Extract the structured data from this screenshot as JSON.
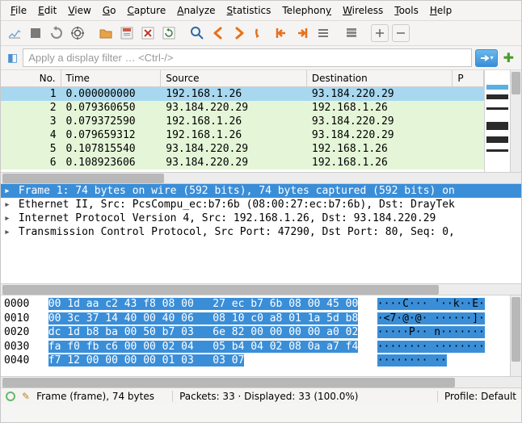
{
  "menu": {
    "file": "File",
    "edit": "Edit",
    "view": "View",
    "go": "Go",
    "capture": "Capture",
    "analyze": "Analyze",
    "statistics": "Statistics",
    "telephony": "Telephony",
    "wireless": "Wireless",
    "tools": "Tools",
    "help": "Help"
  },
  "toolbar_icons": [
    "fin-icon",
    "stop-icon",
    "restart-icon",
    "options-icon",
    "open-icon",
    "save-icon",
    "close-icon",
    "reload-icon",
    "find-icon",
    "back-icon",
    "forward-icon",
    "jump-icon",
    "first-icon",
    "last-icon",
    "autoscroll-icon",
    "colorize-icon",
    "zoom-in-icon",
    "zoom-out-icon"
  ],
  "filter": {
    "placeholder": "Apply a display filter … <Ctrl-/>"
  },
  "columns": {
    "no": "No.",
    "time": "Time",
    "source": "Source",
    "destination": "Destination",
    "protocol": "P"
  },
  "packets": [
    {
      "no": "1",
      "time": "0.000000000",
      "src": "192.168.1.26",
      "dst": "93.184.220.29",
      "sel": true,
      "cls": ""
    },
    {
      "no": "2",
      "time": "0.079360650",
      "src": "93.184.220.29",
      "dst": "192.168.1.26",
      "sel": false,
      "cls": "row-green"
    },
    {
      "no": "3",
      "time": "0.079372590",
      "src": "192.168.1.26",
      "dst": "93.184.220.29",
      "sel": false,
      "cls": "row-green"
    },
    {
      "no": "4",
      "time": "0.079659312",
      "src": "192.168.1.26",
      "dst": "93.184.220.29",
      "sel": false,
      "cls": "row-green"
    },
    {
      "no": "5",
      "time": "0.107815540",
      "src": "93.184.220.29",
      "dst": "192.168.1.26",
      "sel": false,
      "cls": "row-green"
    },
    {
      "no": "6",
      "time": "0.108923606",
      "src": "93.184.220.29",
      "dst": "192.168.1.26",
      "sel": false,
      "cls": "row-green"
    }
  ],
  "details": [
    {
      "text": "Frame 1: 74 bytes on wire (592 bits), 74 bytes captured (592 bits) on",
      "sel": true,
      "exp": true
    },
    {
      "text": "Ethernet II, Src: PcsCompu_ec:b7:6b (08:00:27:ec:b7:6b), Dst: DrayTek",
      "sel": false,
      "exp": true
    },
    {
      "text": "Internet Protocol Version 4, Src: 192.168.1.26, Dst: 93.184.220.29",
      "sel": false,
      "exp": true
    },
    {
      "text": "Transmission Control Protocol, Src Port: 47290, Dst Port: 80, Seq: 0,",
      "sel": false,
      "exp": true
    }
  ],
  "hex": [
    {
      "off": "0000",
      "b1": "00 1d aa c2 43 f8 08 00",
      "b2": "27 ec b7 6b 08 00 45 00",
      "a": "····C··· '··k··E·"
    },
    {
      "off": "0010",
      "b1": "00 3c 37 14 40 00 40 06",
      "b2": "08 10 c0 a8 01 1a 5d b8",
      "a": "·<7·@·@· ······]·"
    },
    {
      "off": "0020",
      "b1": "dc 1d b8 ba 00 50 b7 03",
      "b2": "6e 82 00 00 00 00 a0 02",
      "a": "·····P·· n·······"
    },
    {
      "off": "0030",
      "b1": "fa f0 fb c6 00 00 02 04",
      "b2": "05 b4 04 02 08 0a a7 f4",
      "a": "········ ········"
    },
    {
      "off": "0040",
      "b1": "f7 12 00 00 00 00 01 03",
      "b2": "03 07",
      "a": "········ ··",
      "short": true
    }
  ],
  "status": {
    "frame": "Frame (frame), 74 bytes",
    "packets": "Packets: 33 · Displayed: 33 (100.0%)",
    "profile": "Profile: Default"
  }
}
